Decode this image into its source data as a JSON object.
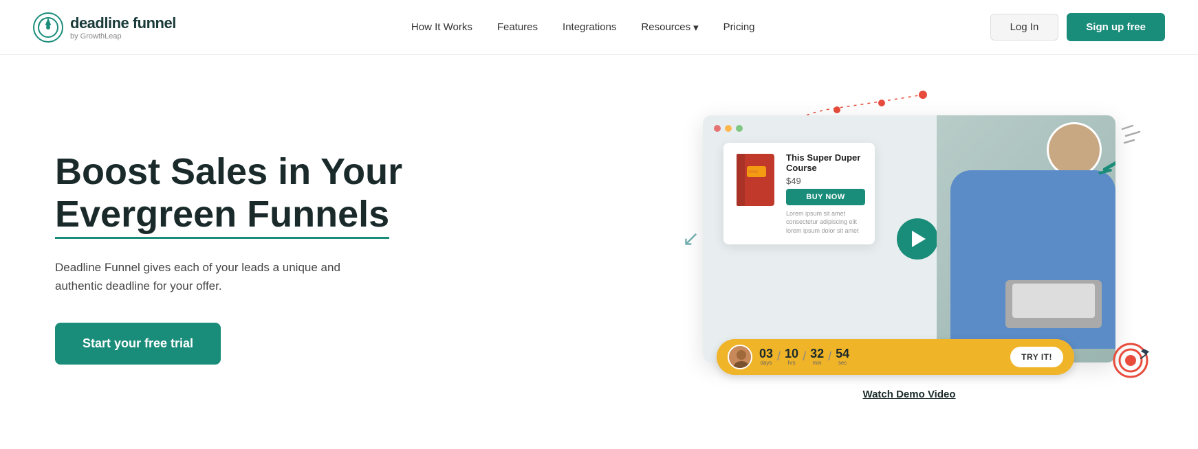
{
  "logo": {
    "main": "deadline funnel",
    "sub": "by GrowthLeap",
    "icon_alt": "deadline-funnel-logo"
  },
  "nav": {
    "links": [
      {
        "label": "How It Works",
        "id": "how-it-works"
      },
      {
        "label": "Features",
        "id": "features"
      },
      {
        "label": "Integrations",
        "id": "integrations"
      },
      {
        "label": "Resources",
        "id": "resources",
        "has_dropdown": true
      },
      {
        "label": "Pricing",
        "id": "pricing"
      }
    ],
    "login_label": "Log In",
    "signup_label": "Sign up free"
  },
  "hero": {
    "headline_line1": "Boost Sales in Your",
    "headline_line2": "Evergreen Funnels",
    "subtext": "Deadline Funnel gives each of your leads a unique and authentic deadline for your offer.",
    "cta_label": "Start your free trial"
  },
  "product_card": {
    "title": "This Super Duper Course",
    "price": "$49",
    "buy_label": "BUY NOW"
  },
  "countdown": {
    "days": "03",
    "hours": "10",
    "minutes": "32",
    "seconds": "54",
    "days_label": "days",
    "hours_label": "hrs",
    "minutes_label": "min",
    "seconds_label": "sec",
    "cta": "TRY IT!"
  },
  "demo": {
    "watch_label": "Watch Demo Video"
  },
  "colors": {
    "brand_teal": "#1a8c7a",
    "brand_dark": "#1a2a2a",
    "countdown_yellow": "#f0b429"
  }
}
